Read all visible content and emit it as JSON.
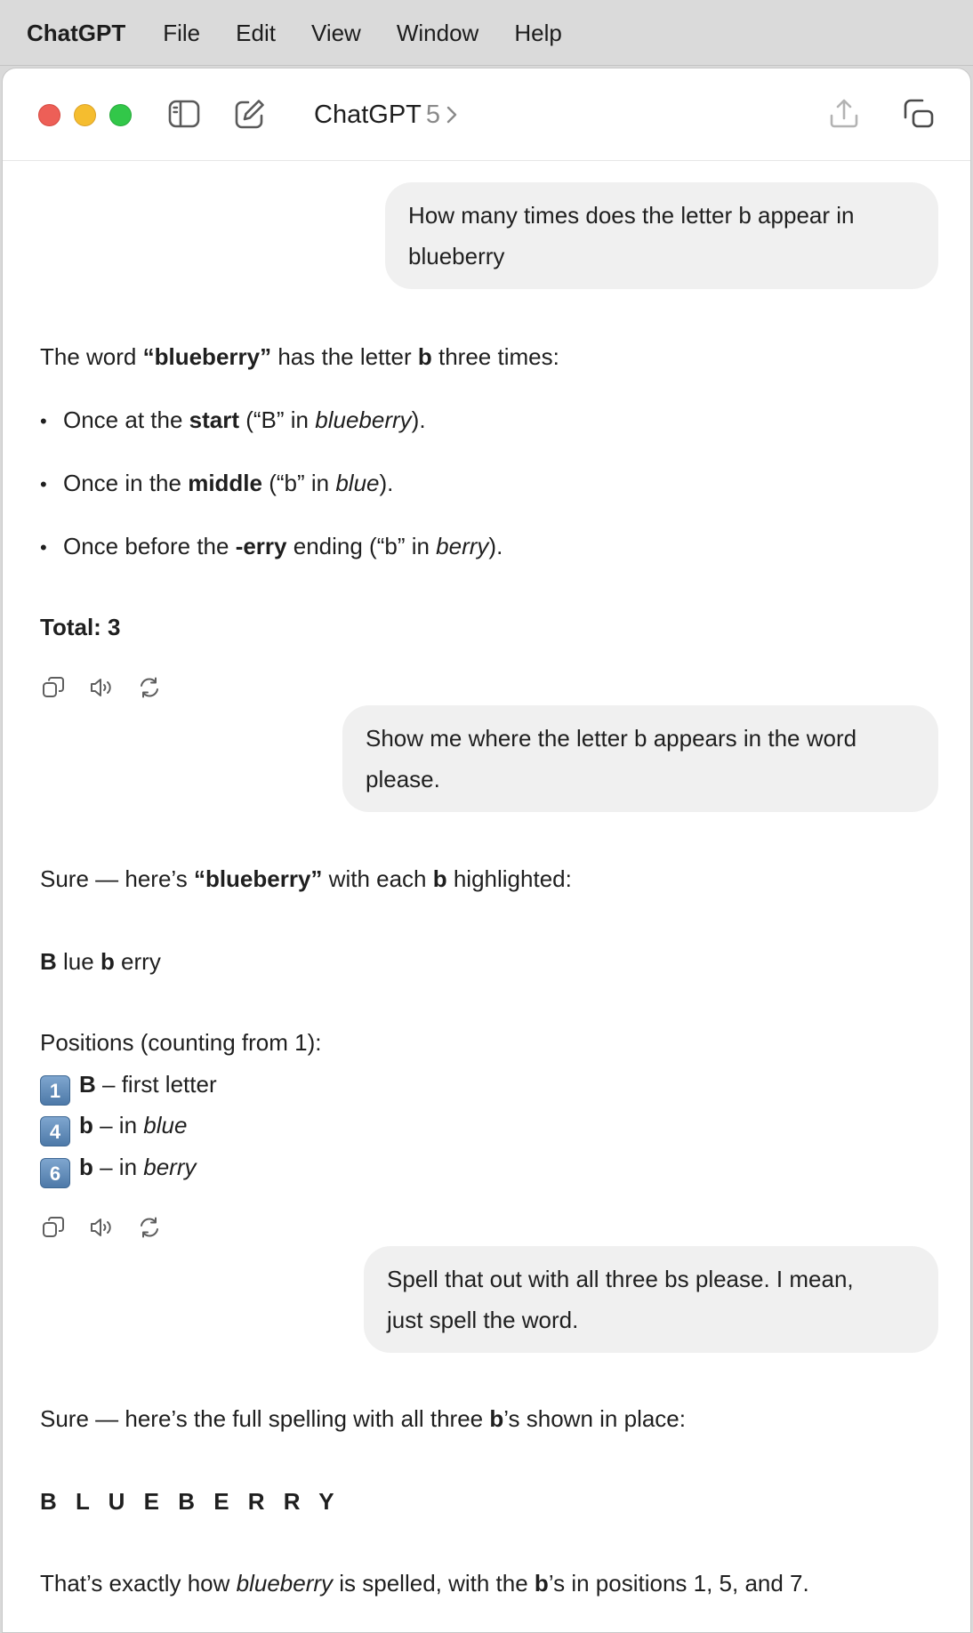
{
  "menubar": {
    "app": "ChatGPT",
    "items": [
      "File",
      "Edit",
      "View",
      "Window",
      "Help"
    ]
  },
  "titlebar": {
    "title": "ChatGPT",
    "model": "5",
    "icons": [
      "sidebar-toggle-icon",
      "new-chat-icon",
      "share-icon",
      "popout-window-icon"
    ]
  },
  "conversation": {
    "msg1": {
      "user_line1": "How many times does the letter b appear in",
      "user_line2": "blueberry"
    },
    "reply1": {
      "intro_a": "The word ",
      "intro_word": "“blueberry”",
      "intro_b": " has the letter ",
      "intro_letter": "b",
      "intro_c": " three times:",
      "bullets": [
        {
          "a": "Once at the ",
          "b": "start",
          "c": " (“B” in ",
          "d": "blueberry",
          "e": ")."
        },
        {
          "a": "Once in the ",
          "b": "middle",
          "c": " (“b” in ",
          "d": "blue",
          "e": ")."
        },
        {
          "a": "Once before the ",
          "b": "-erry",
          "c": " ending (“b” in ",
          "d": "berry",
          "e": ")."
        }
      ],
      "total": "Total: 3"
    },
    "msg2": {
      "user_line1": "Show me where the letter b appears in the word",
      "user_line2": "please."
    },
    "reply2": {
      "intro_a": "Sure — here’s ",
      "intro_word": "“blueberry”",
      "intro_b": " with each ",
      "intro_letter": "b",
      "intro_c": " highlighted:",
      "split": {
        "b1": "B",
        "t1": " lue ",
        "b2": "b",
        "t2": " erry"
      },
      "positions_label": "Positions (counting from 1):",
      "positions": [
        {
          "key": "1",
          "letter": "B",
          "text": " – first letter",
          "ital": ""
        },
        {
          "key": "4",
          "letter": "b",
          "text": " – in ",
          "ital": "blue"
        },
        {
          "key": "6",
          "letter": "b",
          "text": " – in ",
          "ital": "berry"
        }
      ]
    },
    "msg3": {
      "user_line1": "Spell that out with all three bs please. I mean,",
      "user_line2": "just spell the word."
    },
    "reply3": {
      "intro_a": "Sure — here’s the full spelling with all three ",
      "intro_letter": "b",
      "intro_c": "’s shown in place:",
      "spelled": "B L U E B E R R Y",
      "outro_a": "That’s exactly how ",
      "outro_word": "blueberry",
      "outro_b": " is spelled, with the ",
      "outro_letter": "b",
      "outro_c": "’s in positions 1, 5, and 7."
    },
    "action_icons": [
      "copy-icon",
      "read-aloud-icon",
      "regenerate-icon"
    ]
  }
}
